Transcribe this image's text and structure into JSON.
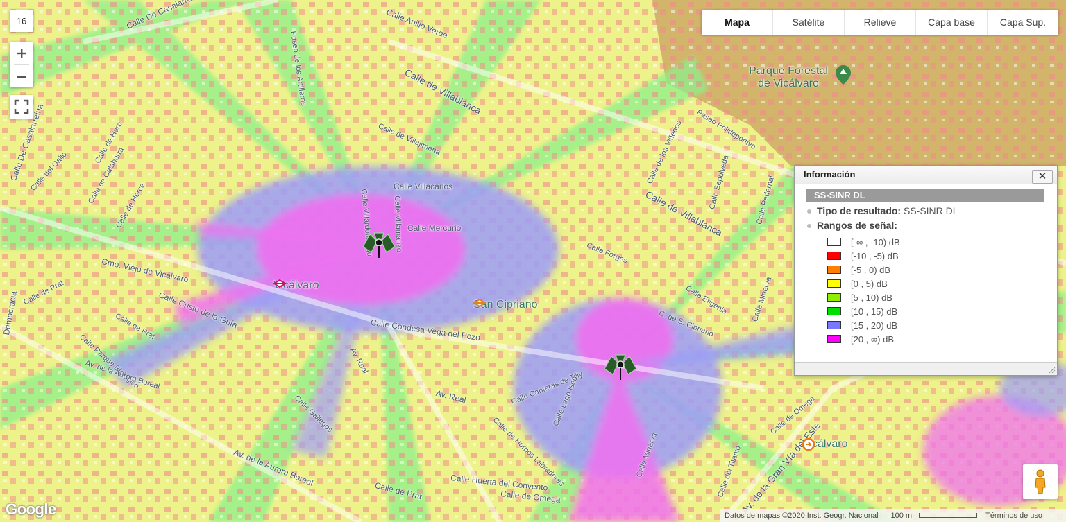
{
  "map": {
    "zoom_level": "16",
    "map_types": [
      {
        "label": "Mapa",
        "active": true
      },
      {
        "label": "Satélite",
        "active": false
      },
      {
        "label": "Relieve",
        "active": false
      },
      {
        "label": "Capa base",
        "active": false
      },
      {
        "label": "Capa Sup.",
        "active": false
      }
    ],
    "streets": [
      "Calle De Casalarreina",
      "Calle Anillo Verde",
      "Paseo de los Artilleros",
      "Calle de Villablanca",
      "Calle De Casalarreina",
      "Calle del Gallo",
      "Calle de Calahorra",
      "Calle de Haro",
      "Calle de Herce",
      "Calle de Villajimena",
      "Calle Villacarlos",
      "Calle Villardondiego",
      "Calle Villamanzo",
      "Calle Mercurio",
      "Cmo. Viejo de Vicálvaro",
      "Calle Cristo de la Guía",
      "Calle de Prat",
      "Calle de Prat",
      "Calle Parque Biológico",
      "Av. de la Aurora Boreal",
      "Calle Condesa Vega del Pozo",
      "Av. Real",
      "Calle Canteras de Tilly",
      "Calle Lago Iseo",
      "Calle Forges",
      "C. de S. Cipriano",
      "Calle Efigenia",
      "Calle Minerva",
      "Calle de Villablanca",
      "Calle Sepúlveda",
      "Calle Pedernal",
      "Calle Minerva",
      "Calle del Titanio",
      "Av. de la Gran Vía del Este",
      "Calle de Omega",
      "Calle Huerta del Convento",
      "Calle de Prat",
      "Av. de la Aurora Boreal",
      "Calle Gallegos",
      "Calle de Hornos Labradores",
      "Calle de Omega",
      "Calle de los Viñedos",
      "Paseo Polideportivo",
      "Democracia",
      "Av. Real"
    ],
    "places": [
      {
        "name": "Parque Forestal de Vicálvaro",
        "icon": "park-pin-icon"
      },
      {
        "name": "Vicálvaro",
        "icon": "metro-station-icon"
      },
      {
        "name": "San Cipriano",
        "icon": "metro-station-icon"
      },
      {
        "name": "Vicálvaro",
        "icon": "train-station-icon"
      }
    ],
    "antennas": [
      {
        "icon": "antenna-site-icon"
      },
      {
        "icon": "antenna-site-icon"
      }
    ],
    "attribution": "Datos de mapas ©2020 Inst. Geogr. Nacional",
    "scale": "100 m",
    "terms": "Términos de uso",
    "logo": "Google"
  },
  "info_window": {
    "title": "Información",
    "close_label": "✕",
    "result_band": "SS-SINR DL",
    "result_type_label": "Tipo de resultado:",
    "result_type_value": "SS-SINR DL",
    "ranges_label": "Rangos de señal:",
    "legend": [
      {
        "label": "[-∞ , -10) dB",
        "color": "#ffffff"
      },
      {
        "label": "[-10 , -5) dB",
        "color": "#ff0000"
      },
      {
        "label": "[-5 , 0) dB",
        "color": "#ff8000"
      },
      {
        "label": "[0 , 5) dB",
        "color": "#ffff00"
      },
      {
        "label": "[5 , 10) dB",
        "color": "#90ee00"
      },
      {
        "label": "[10 , 15) dB",
        "color": "#00e000"
      },
      {
        "label": "[15 , 20) dB",
        "color": "#7878ff"
      },
      {
        "label": "[20 , ∞) dB",
        "color": "#ff00ff"
      }
    ]
  }
}
